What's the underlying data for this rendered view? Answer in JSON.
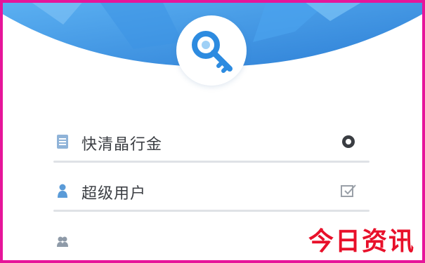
{
  "menu": {
    "items": [
      {
        "label": "快清晶行金",
        "icon": "list-icon",
        "action_icon": "settings-gear-icon"
      },
      {
        "label": "超级用户",
        "icon": "user-icon",
        "action_icon": "edit-check-icon"
      },
      {
        "label": "",
        "icon": "group-icon"
      }
    ]
  },
  "header": {
    "icon": "key-icon",
    "accent": "#2d8be0"
  },
  "watermark": {
    "text": "今日资讯",
    "color": "#e8102a"
  },
  "frame": {
    "color": "#e6159a"
  }
}
